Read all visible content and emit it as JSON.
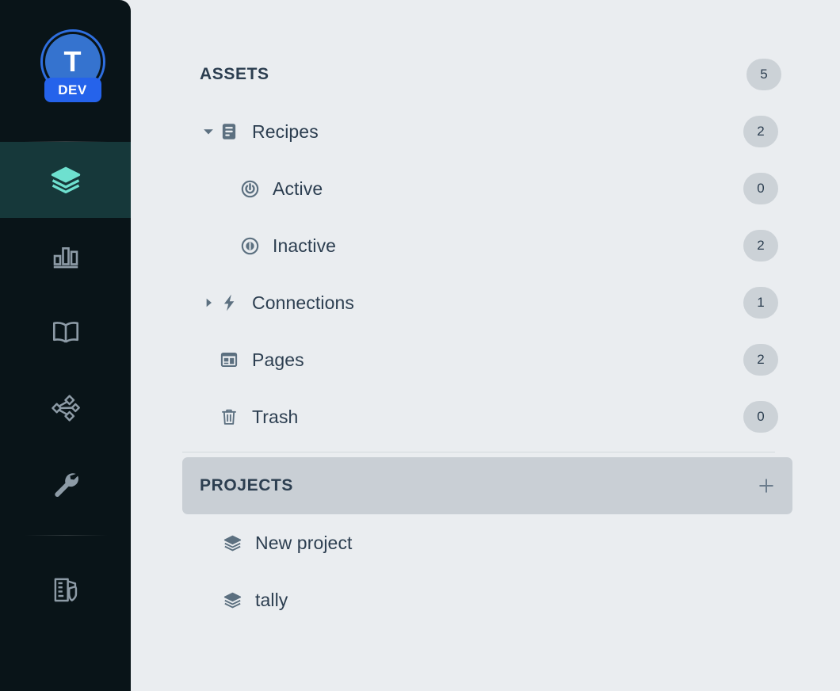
{
  "app": {
    "logo_letter": "T",
    "logo_badge": "DEV",
    "accent_blue": "#2563eb",
    "accent_teal": "#6ee0cf",
    "rail_bg": "#091418",
    "panel_bg": "#eaedf0",
    "text_color": "#2c3e50",
    "badge_bg": "#ccd2d7",
    "highlight_bg": "#c9cfd5"
  },
  "rail": {
    "items": [
      {
        "name": "projects",
        "icon": "layers-icon",
        "active": true
      },
      {
        "name": "analytics",
        "icon": "bar-chart-icon",
        "active": false
      },
      {
        "name": "library",
        "icon": "book-icon",
        "active": false
      },
      {
        "name": "workflows",
        "icon": "nodes-icon",
        "active": false
      },
      {
        "name": "tools",
        "icon": "wrench-icon",
        "active": false
      }
    ],
    "bottom_items": [
      {
        "name": "admin",
        "icon": "building-shield-icon",
        "active": false
      }
    ]
  },
  "assets": {
    "title": "ASSETS",
    "count": "5",
    "rows": [
      {
        "label": "Recipes",
        "count": "2",
        "icon": "recipe-icon",
        "caret": "down",
        "indent": 1
      },
      {
        "label": "Active",
        "count": "0",
        "icon": "power-on-icon",
        "caret": "none",
        "indent": 2
      },
      {
        "label": "Inactive",
        "count": "2",
        "icon": "power-off-icon",
        "caret": "none",
        "indent": 2
      },
      {
        "label": "Connections",
        "count": "1",
        "icon": "bolt-icon",
        "caret": "right",
        "indent": 1
      },
      {
        "label": "Pages",
        "count": "2",
        "icon": "pages-icon",
        "caret": "none",
        "indent": 1
      },
      {
        "label": "Trash",
        "count": "0",
        "icon": "trash-icon",
        "caret": "none",
        "indent": 1
      }
    ]
  },
  "projects": {
    "title": "PROJECTS",
    "add_label": "+",
    "rows": [
      {
        "label": "New project",
        "icon": "layers-icon"
      },
      {
        "label": "tally",
        "icon": "layers-icon"
      }
    ]
  }
}
